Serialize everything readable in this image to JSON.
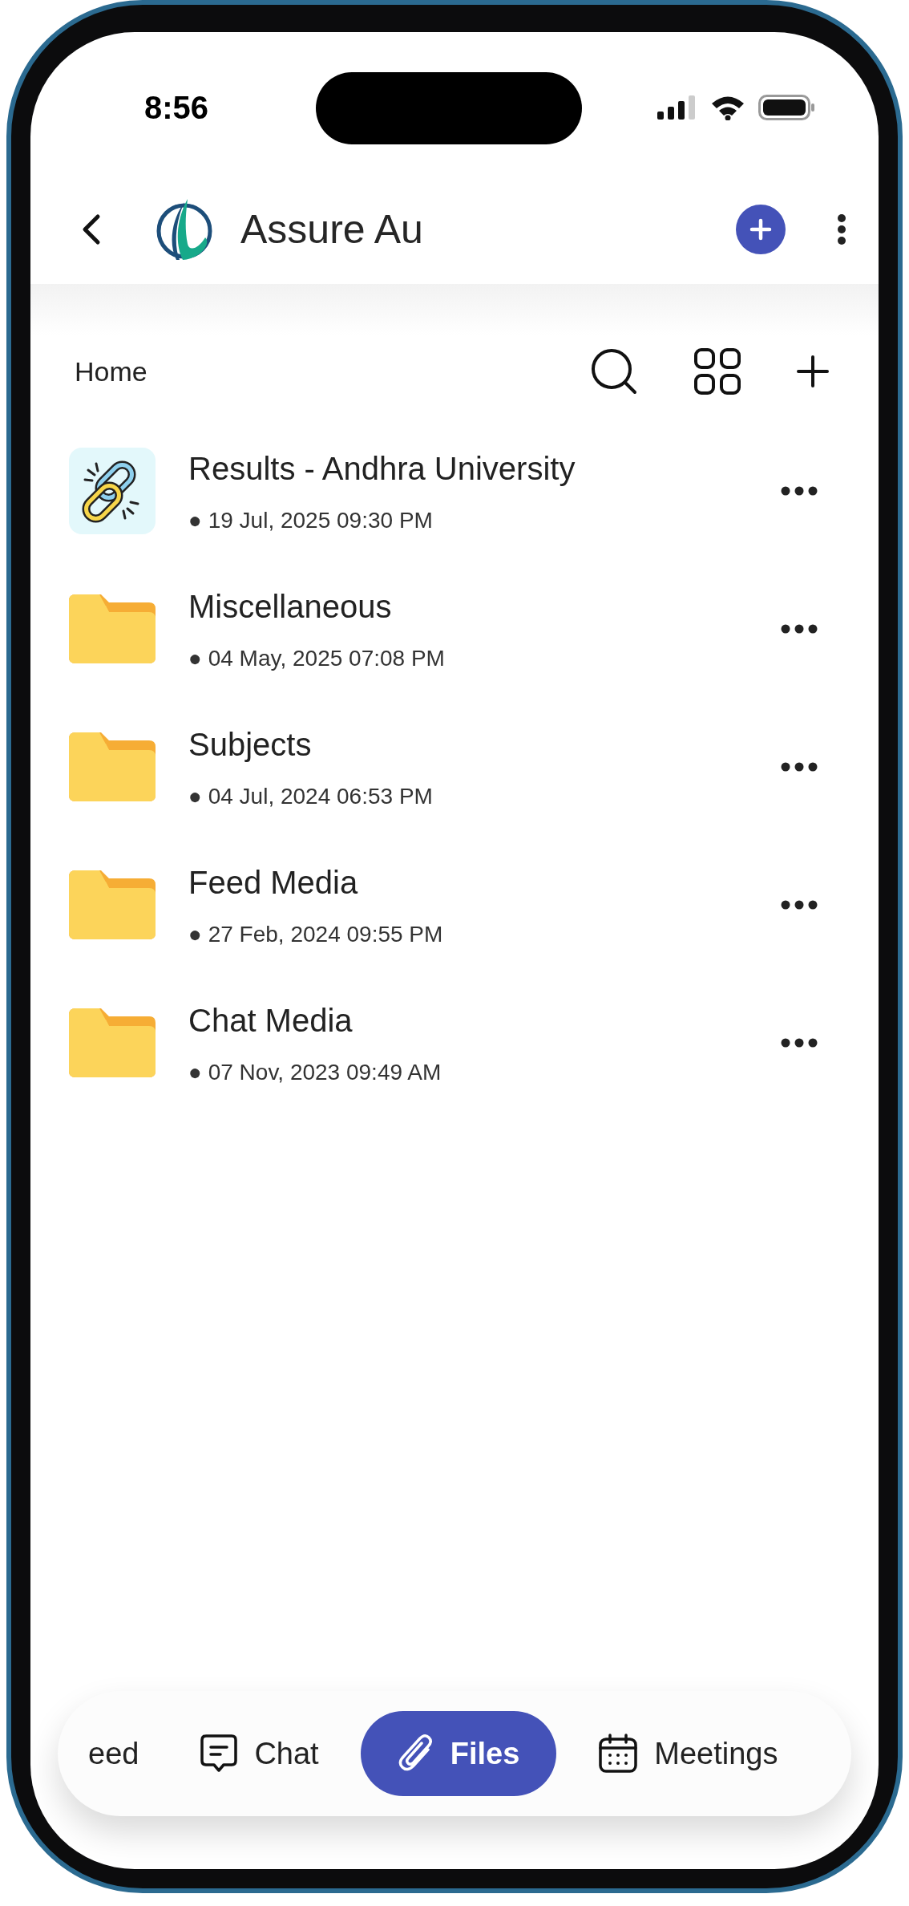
{
  "status_bar": {
    "time": "8:56"
  },
  "header": {
    "title": "Assure Au"
  },
  "toolbar": {
    "breadcrumb": "Home"
  },
  "items": [
    {
      "kind": "link",
      "name": "Results - Andhra University",
      "date": "● 19 Jul, 2025 09:30 PM"
    },
    {
      "kind": "folder",
      "name": "Miscellaneous",
      "date": "● 04 May, 2025 07:08 PM"
    },
    {
      "kind": "folder",
      "name": "Subjects",
      "date": "● 04 Jul, 2024 06:53 PM"
    },
    {
      "kind": "folder",
      "name": "Feed Media",
      "date": "● 27 Feb, 2024 09:55 PM"
    },
    {
      "kind": "folder",
      "name": "Chat Media",
      "date": "● 07 Nov, 2023 09:49 AM"
    }
  ],
  "tabs": [
    {
      "kind": "feed",
      "label": "eed",
      "selected": false
    },
    {
      "kind": "chat",
      "label": "Chat",
      "selected": false
    },
    {
      "kind": "files",
      "label": "Files",
      "selected": true
    },
    {
      "kind": "meetings",
      "label": "Meetings",
      "selected": false
    }
  ]
}
